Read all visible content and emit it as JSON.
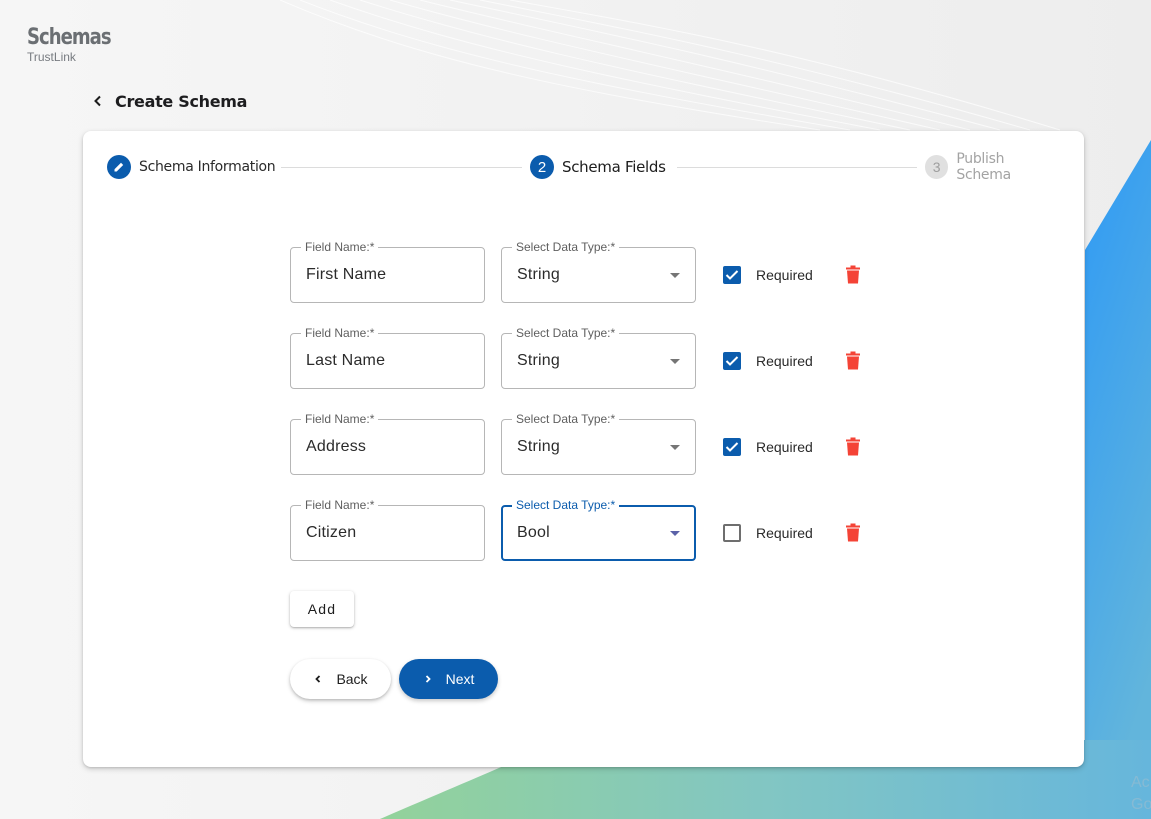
{
  "brand": {
    "title": "Schemas",
    "subtitle": "TrustLink"
  },
  "header": {
    "back_icon": "chevron-left-icon",
    "title": "Create Schema"
  },
  "stepper": {
    "steps": [
      {
        "index": "1",
        "label": "Schema Information",
        "state": "completed",
        "icon": "pencil-icon"
      },
      {
        "index": "2",
        "label": "Schema Fields",
        "state": "active"
      },
      {
        "index": "3",
        "label": "Publish Schema",
        "state": "inactive"
      }
    ]
  },
  "form": {
    "field_name_label": "Field Name:*",
    "data_type_label": "Select Data Type:*",
    "required_label": "Required",
    "rows": [
      {
        "field_name": "First Name",
        "data_type": "String",
        "required": true
      },
      {
        "field_name": "Last Name",
        "data_type": "String",
        "required": true
      },
      {
        "field_name": "Address",
        "data_type": "String",
        "required": true
      },
      {
        "field_name": "Citizen",
        "data_type": "Bool",
        "required": false
      }
    ],
    "add_label": "Add"
  },
  "navigation": {
    "back_label": "Back",
    "next_label": "Next"
  },
  "colors": {
    "primary": "#0b5cad",
    "delete": "#f44336",
    "inactive_step": "#e0e0e0"
  },
  "watermark": {
    "line1": "Ac",
    "line2": "Go"
  }
}
